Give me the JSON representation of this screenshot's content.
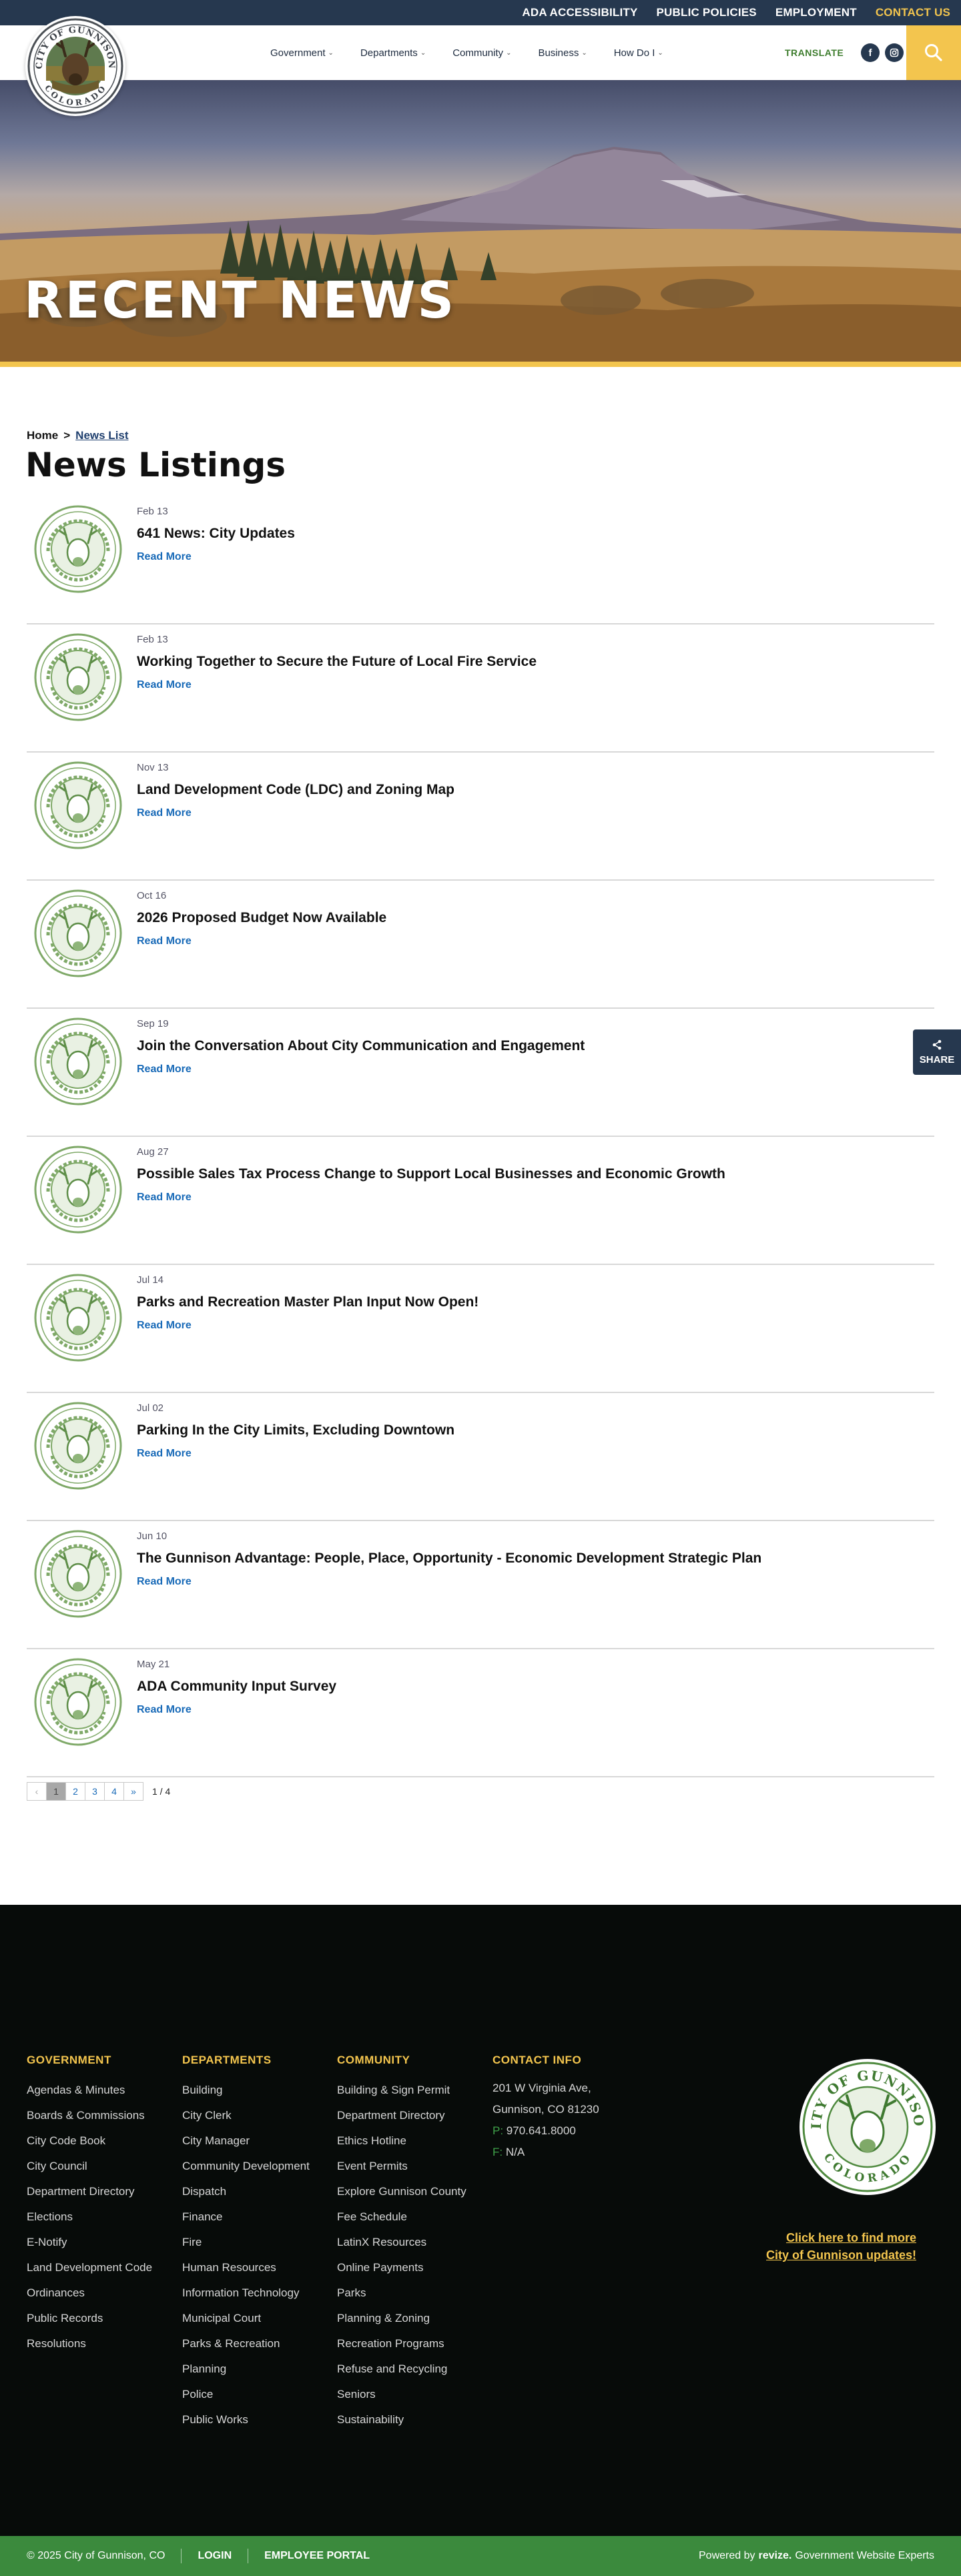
{
  "topbar": {
    "links": [
      "ADA ACCESSIBILITY",
      "PUBLIC POLICIES",
      "EMPLOYMENT",
      "CONTACT US"
    ]
  },
  "header": {
    "logo_text_top": "CITY OF GUNNISON",
    "logo_text_bottom": "COLORADO",
    "nav": [
      "Government",
      "Departments",
      "Community",
      "Business",
      "How Do I"
    ],
    "translate_label": "TRANSLATE",
    "social_icons": [
      "facebook-icon",
      "instagram-icon"
    ],
    "search_icon": "search-icon"
  },
  "hero": {
    "title": "RECENT NEWS"
  },
  "breadcrumb": {
    "home": "Home",
    "separator": ">",
    "current": "News List"
  },
  "page_title": "News Listings",
  "news": [
    {
      "date": "Feb 13",
      "title": "641 News: City Updates",
      "link": "Read More"
    },
    {
      "date": "Feb 13",
      "title": "Working Together to Secure the Future of Local Fire Service",
      "link": "Read More"
    },
    {
      "date": "Nov 13",
      "title": "Land Development Code (LDC) and Zoning Map",
      "link": "Read More"
    },
    {
      "date": "Oct 16",
      "title": "2026 Proposed Budget Now Available",
      "link": "Read More"
    },
    {
      "date": "Sep 19",
      "title": "Join the Conversation About City Communication and Engagement",
      "link": "Read More"
    },
    {
      "date": "Aug 27",
      "title": "Possible Sales Tax Process Change to Support Local Businesses and Economic Growth",
      "link": "Read More"
    },
    {
      "date": "Jul 14",
      "title": "Parks and Recreation Master Plan Input Now Open!",
      "link": "Read More"
    },
    {
      "date": "Jul 02",
      "title": "Parking In the City Limits, Excluding Downtown",
      "link": "Read More"
    },
    {
      "date": "Jun 10",
      "title": "The Gunnison Advantage: People, Place, Opportunity - Economic Development Strategic Plan",
      "link": "Read More"
    },
    {
      "date": "May 21",
      "title": "ADA Community Input Survey",
      "link": "Read More"
    }
  ],
  "pagination": {
    "prev": "‹",
    "pages": [
      "1",
      "2",
      "3",
      "4"
    ],
    "next": "»",
    "count": "1 / 4"
  },
  "share": {
    "label": "SHARE"
  },
  "footer": {
    "government": {
      "heading": "GOVERNMENT",
      "items": [
        "Agendas & Minutes",
        "Boards & Commissions",
        "City Code Book",
        "City Council",
        "Department Directory",
        "Elections",
        "E-Notify",
        "Land Development Code",
        "Ordinances",
        "Public Records",
        "Resolutions"
      ]
    },
    "departments": {
      "heading": "DEPARTMENTS",
      "items": [
        "Building",
        "City Clerk",
        "City Manager",
        "Community Development",
        "Dispatch",
        "Finance",
        "Fire",
        "Human Resources",
        "Information Technology",
        "Municipal Court",
        "Parks & Recreation",
        "Planning",
        "Police",
        "Public Works"
      ]
    },
    "community": {
      "heading": "COMMUNITY",
      "items": [
        "Building & Sign Permit",
        "Department Directory",
        "Ethics Hotline",
        "Event Permits",
        "Explore Gunnison County",
        "Fee Schedule",
        "LatinX Resources",
        "Online Payments",
        "Parks",
        "Planning & Zoning",
        "Recreation Programs",
        "Refuse and Recycling",
        "Seniors",
        "Sustainability"
      ]
    },
    "contact": {
      "heading": "CONTACT INFO",
      "address1": "201 W Virginia Ave,",
      "address2": "Gunnison, CO 81230",
      "phone_label": "P:",
      "phone": "970.641.8000",
      "fax_label": "F:",
      "fax": "N/A"
    },
    "updates_line1": "Click here to find more",
    "updates_line2": "City of Gunnison updates!",
    "copyright": "© 2025 City of Gunnison, CO",
    "login": "LOGIN",
    "employee_portal": "EMPLOYEE PORTAL",
    "powered_prefix": "Powered by",
    "powered_brand": "revize.",
    "powered_suffix": "Government Website Experts"
  },
  "colors": {
    "navy": "#26384f",
    "gold": "#f3c54e",
    "green": "#3b8a3d",
    "link_blue": "#1a6bb8"
  }
}
